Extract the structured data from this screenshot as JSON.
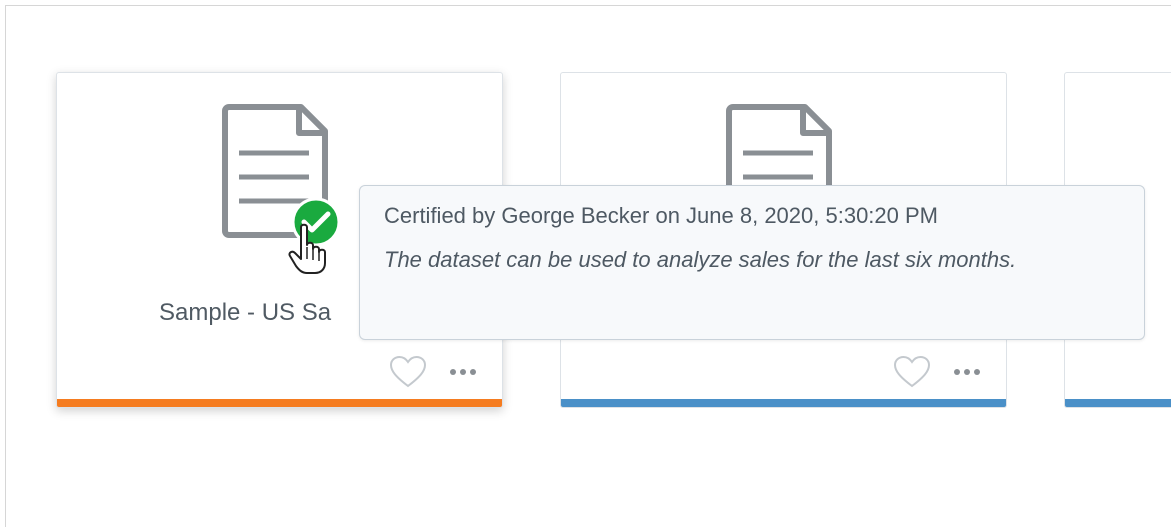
{
  "cards": [
    {
      "title": "Sample - US Sa",
      "accent_color": "#f57c20",
      "icon": "document-icon",
      "certified": true
    },
    {
      "title": "",
      "accent_color": "#4a90c8",
      "icon": "document-icon",
      "certified": false
    },
    {
      "title": "",
      "accent_color": "#4a90c8",
      "icon": "document-icon",
      "certified": false
    }
  ],
  "tooltip": {
    "title": "Certified by George Becker on June 8, 2020, 5:30:20 PM",
    "description": "The dataset can be used to analyze sales for the last six months."
  },
  "colors": {
    "certified_green": "#1aaa3f",
    "icon_gray": "#8a8f94",
    "action_gray": "#b9bec3"
  },
  "icons": {
    "favorite": "heart-icon",
    "more": "more-options-icon",
    "certified": "checkmark-circle-icon",
    "cursor": "hand-pointer-icon"
  }
}
